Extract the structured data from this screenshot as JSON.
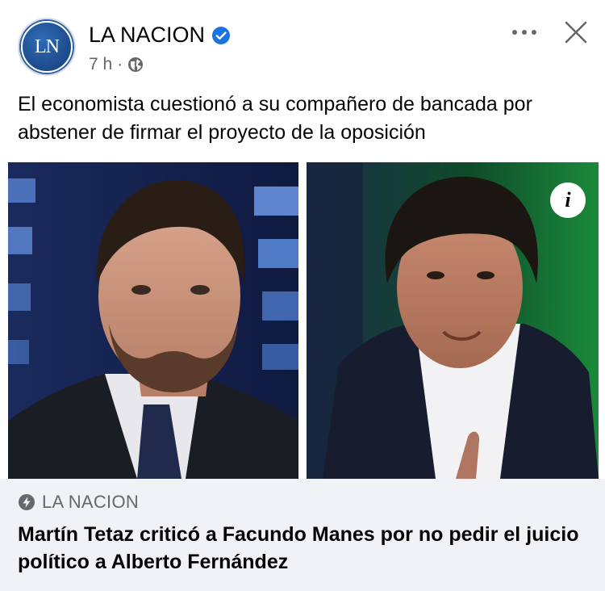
{
  "post": {
    "page_name": "LA NACION",
    "avatar_text": "LN",
    "time": "7 h",
    "separator": "·",
    "caption": "El economista cuestionó a su compañero de bancada por abstener de firmar el proyecto de la oposición"
  },
  "icons": {
    "verified": "verified-badge-icon",
    "audience": "globe-icon",
    "more": "more-options-icon",
    "close": "close-icon",
    "info": "info-icon",
    "source": "bolt-icon"
  },
  "info_glyph": "i",
  "link": {
    "source": "LA NACION",
    "headline": "Martín Tetaz criticó a Facundo Manes por no pedir el juicio político a Alberto Fernández"
  },
  "colors": {
    "verified": "#1b74e4",
    "secondary_text": "#65676b",
    "link_background": "#f0f2f5"
  }
}
